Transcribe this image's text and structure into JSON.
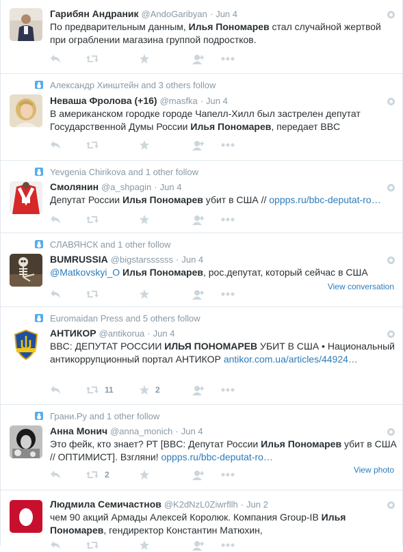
{
  "tweets": [
    {
      "context": "",
      "fullname": "Гарибян Андраник",
      "username": "@AndoGaribyan",
      "time": "Jun 4",
      "text": [
        {
          "t": "По предварительным данным, "
        },
        {
          "t": "Илья Пономарев",
          "b": true
        },
        {
          "t": " стал случайной жертвой при ограблении магазина группой подростков."
        }
      ],
      "retweets": "",
      "favorites": "",
      "expand": ""
    },
    {
      "context": "Александр Хинштейн and 3 others follow",
      "fullname": "Неваша Фролова (+16)",
      "username": "@masfka",
      "time": "Jun 4",
      "text": [
        {
          "t": "В американском городке городе Чапелл-Хилл был застрелен депутат Государственной Думы России "
        },
        {
          "t": "Илья Пономарев",
          "b": true
        },
        {
          "t": ", передает BBC"
        }
      ],
      "retweets": "",
      "favorites": "",
      "expand": ""
    },
    {
      "context": "Yevgenia Chirikova and 1 other follow",
      "fullname": "Смолянин",
      "username": "@a_shpagin",
      "time": "Jun 4",
      "text": [
        {
          "t": "Депутат России "
        },
        {
          "t": "Илья Пономарев",
          "b": true
        },
        {
          "t": " убит в США // "
        },
        {
          "t": "oppps.ru/bbc-deputat-ro…",
          "link": true
        }
      ],
      "retweets": "",
      "favorites": "",
      "expand": ""
    },
    {
      "context": "СЛАВЯНСК and 1 other follow",
      "fullname": "BUMRUSSIA",
      "username": "@bigstarssssss",
      "time": "Jun 4",
      "text": [
        {
          "t": "@Matkovskyi_O",
          "link": true
        },
        {
          "t": " "
        },
        {
          "t": "Илья Пономарев",
          "b": true
        },
        {
          "t": ", рос.депутат, который сейчас в США"
        }
      ],
      "retweets": "",
      "favorites": "",
      "expand": "View conversation"
    },
    {
      "context": "Euromaidan Press and 5 others follow",
      "fullname": "АНТИКОР",
      "username": "@antikorua",
      "time": "Jun 4",
      "text": [
        {
          "t": "BBC: ДЕПУТАТ РОССИИ "
        },
        {
          "t": "ИЛЬЯ ПОНОМАРЕВ",
          "b": true
        },
        {
          "t": " УБИТ В США • Национальный антикоррупционный портал АНТИКОР "
        },
        {
          "t": "antikor.com.ua/articles/44924…",
          "link": true
        }
      ],
      "retweets": "11",
      "favorites": "2",
      "expand": ""
    },
    {
      "context": "Грани.Ру and 1 other follow",
      "fullname": "Анна Монич",
      "username": "@anna_monich",
      "time": "Jun 4",
      "text": [
        {
          "t": "Это фейк, кто знает? РТ [BBC: Депутат России "
        },
        {
          "t": "Илья Пономарев",
          "b": true
        },
        {
          "t": " убит в США // ОПТИМИСТ]. Взгляни! "
        },
        {
          "t": "oppps.ru/bbc-deputat-ro…",
          "link": true
        }
      ],
      "retweets": "2",
      "favorites": "",
      "expand": "View photo"
    },
    {
      "context": "",
      "fullname": "Людмила Семичастнов",
      "username": "@K2dNzL0Ziwrfllh",
      "time": "Jun 2",
      "text": [
        {
          "t": "чем 90 акций Армады Алексей Королюк. Компания Group-IB "
        },
        {
          "t": "Илья Пономарев",
          "b": true
        },
        {
          "t": ", гендиректор Константин Матюхин,"
        }
      ],
      "retweets": "",
      "favorites": "",
      "expand": ""
    }
  ]
}
